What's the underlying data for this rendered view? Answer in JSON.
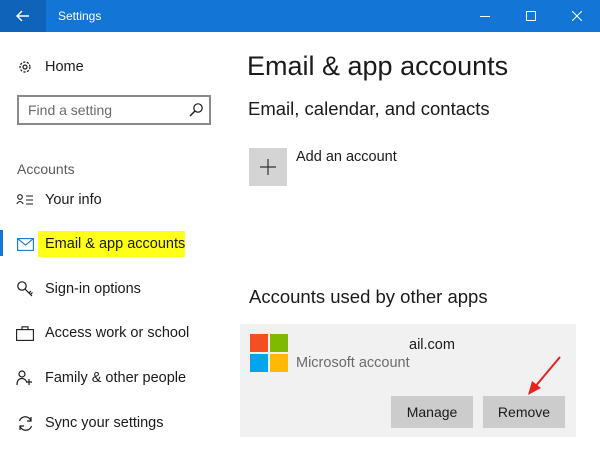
{
  "window": {
    "title": "Settings",
    "titlebar_color": "#1376d6"
  },
  "sidebar": {
    "home_label": "Home",
    "search_placeholder": "Find a setting",
    "section_label": "Accounts",
    "items": [
      {
        "label": "Your info",
        "icon": "person-card-icon"
      },
      {
        "label": "Email & app accounts",
        "icon": "mail-icon",
        "active": true
      },
      {
        "label": "Sign-in options",
        "icon": "key-icon"
      },
      {
        "label": "Access work or school",
        "icon": "briefcase-icon"
      },
      {
        "label": "Family & other people",
        "icon": "people-icon"
      },
      {
        "label": "Sync your settings",
        "icon": "sync-icon"
      }
    ],
    "highlight_color": "#ffff19"
  },
  "main": {
    "title": "Email & app accounts",
    "section1_title": "Email, calendar, and contacts",
    "add_account_label": "Add an account",
    "section2_title": "Accounts used by other apps",
    "account": {
      "email": "ail.com",
      "type": "Microsoft account",
      "manage_label": "Manage",
      "remove_label": "Remove"
    }
  },
  "annotation": {
    "arrow_color": "#e8231e"
  }
}
